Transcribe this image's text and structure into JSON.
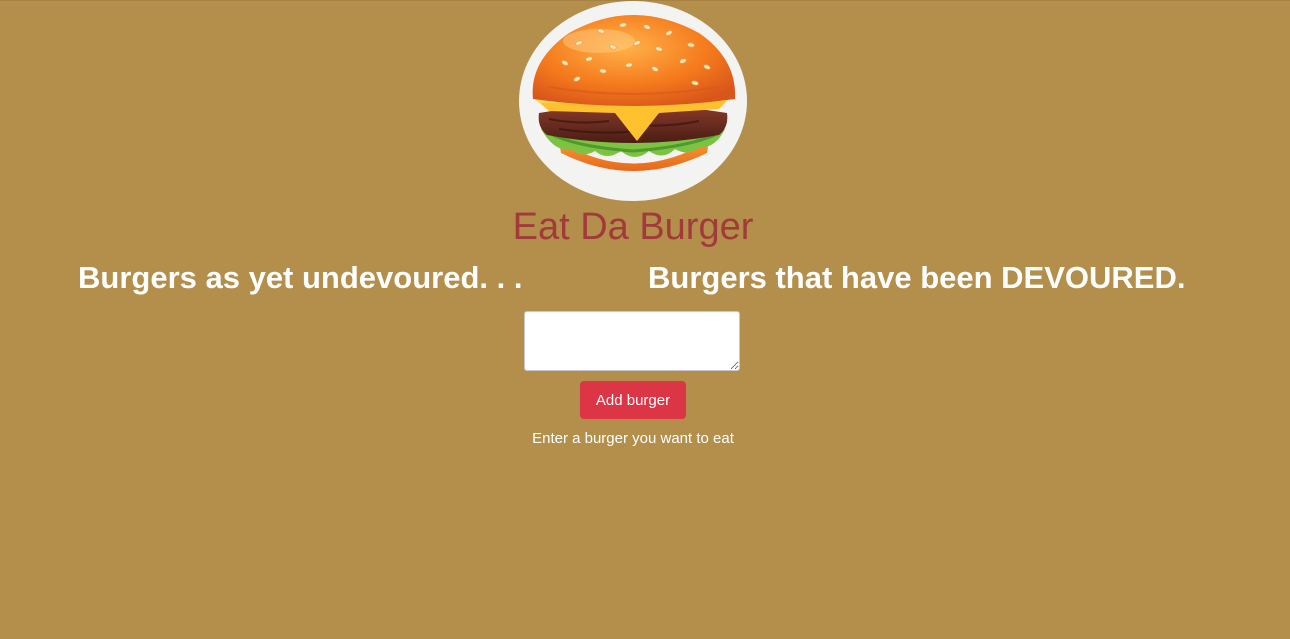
{
  "header": {
    "logo_icon": "burger-icon",
    "title": "Eat Da Burger"
  },
  "columns": {
    "undevoured_heading": "Burgers as yet undevoured. . .",
    "devoured_heading": "Burgers that have been DEVOURED."
  },
  "form": {
    "burger_input_value": "",
    "burger_input_placeholder": "",
    "add_button_label": "Add burger",
    "hint": "Enter a burger you want to eat"
  },
  "colors": {
    "page_background": "#b38f4b",
    "title": "#a23a3c",
    "button": "#dc3545"
  }
}
